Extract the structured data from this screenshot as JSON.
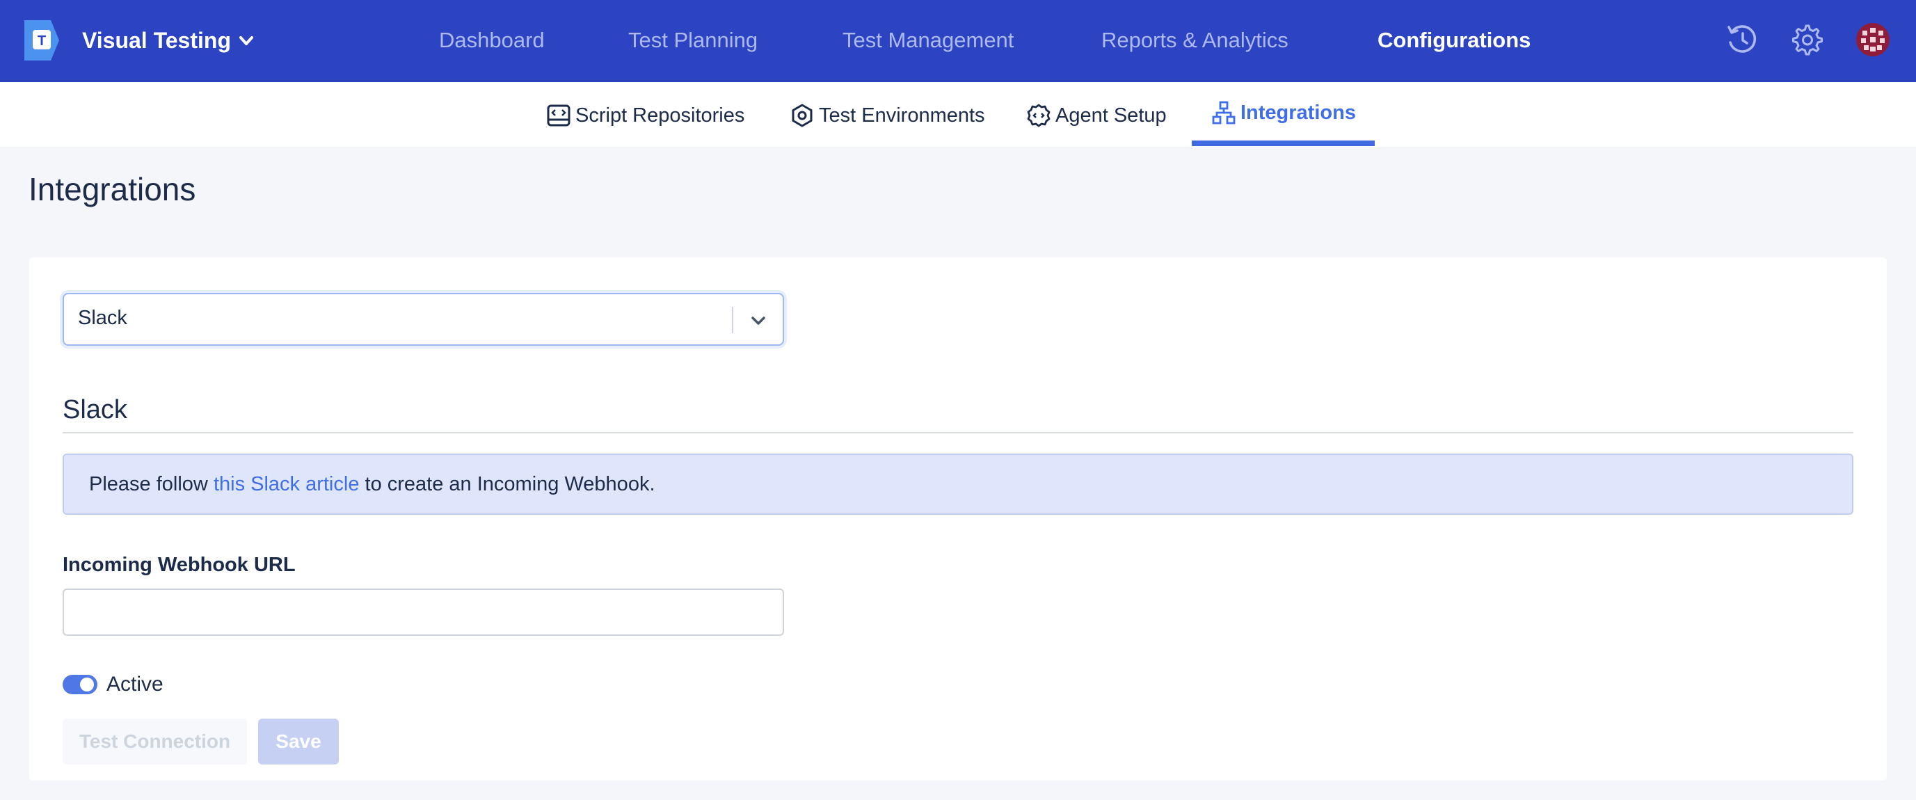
{
  "header": {
    "app_title": "Visual Testing",
    "logo_letter": "T",
    "nav": [
      {
        "label": "Dashboard",
        "active": false
      },
      {
        "label": "Test Planning",
        "active": false
      },
      {
        "label": "Test Management",
        "active": false
      },
      {
        "label": "Reports & Analytics",
        "active": false
      },
      {
        "label": "Configurations",
        "active": true
      }
    ],
    "icons": [
      "history-icon",
      "gear-icon",
      "avatar"
    ]
  },
  "subnav": {
    "items": [
      {
        "label": "Script Repositories",
        "icon": "code-window-icon",
        "active": false
      },
      {
        "label": "Test Environments",
        "icon": "hexagon-icon",
        "active": false
      },
      {
        "label": "Agent Setup",
        "icon": "agent-gear-icon",
        "active": false
      },
      {
        "label": "Integrations",
        "icon": "network-icon",
        "active": true
      }
    ]
  },
  "page": {
    "title": "Integrations",
    "integration_select": {
      "value": "Slack"
    },
    "section_title": "Slack",
    "info": {
      "prefix": "Please follow ",
      "link": "this Slack article",
      "suffix": " to create an Incoming Webhook."
    },
    "webhook": {
      "label": "Incoming Webhook URL",
      "value": ""
    },
    "active_toggle": {
      "label": "Active",
      "on": true
    },
    "buttons": {
      "test_connection": "Test Connection",
      "save": "Save"
    }
  },
  "colors": {
    "header_bg": "#2c44c2",
    "accent": "#4169e1",
    "info_bg": "#dfe5fb",
    "link": "#3f6fe8"
  }
}
